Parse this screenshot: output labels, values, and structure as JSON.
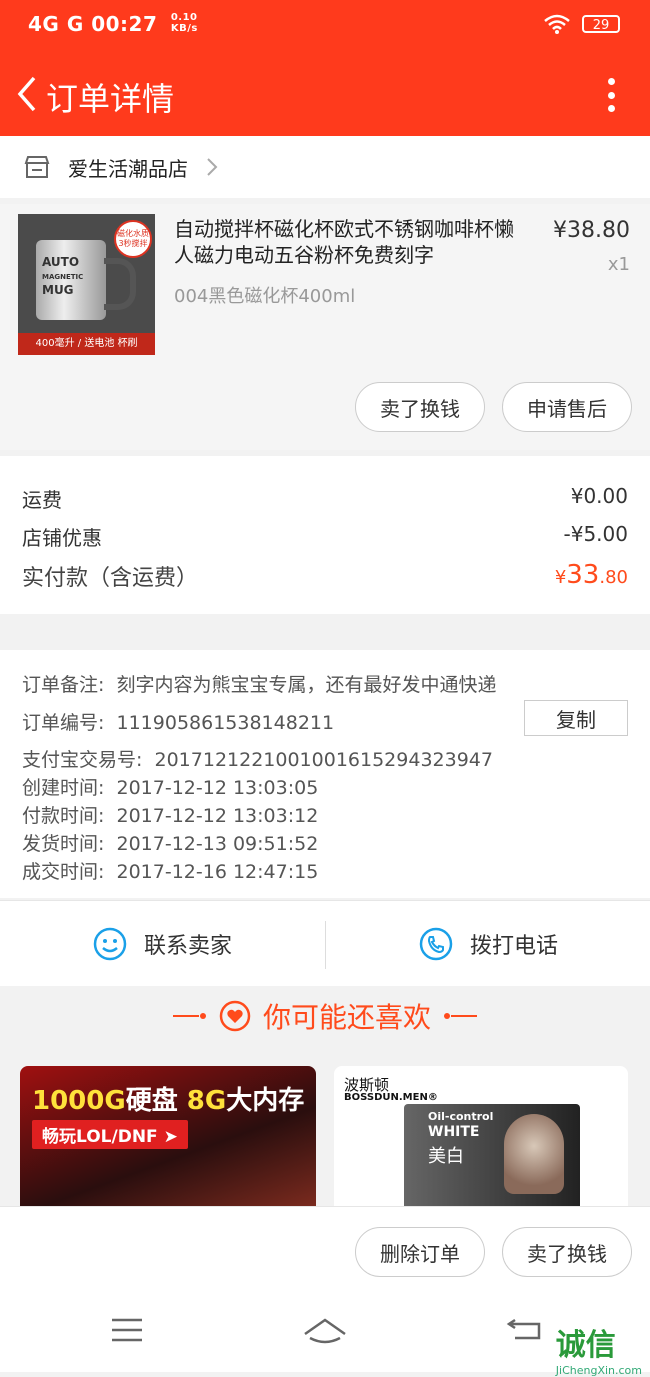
{
  "status_bar": {
    "network": "4G",
    "signal": "G",
    "time": "00:27",
    "speed_value": "0.10",
    "speed_unit": "KB/s",
    "battery": "29"
  },
  "header": {
    "title": "订单详情"
  },
  "shop": {
    "name": "爱生活潮品店"
  },
  "product": {
    "title": "自动搅拌杯磁化杯欧式不锈钢咖啡杯懒人磁力电动五谷粉杯免费刻字",
    "sku": "004黑色磁化杯400ml",
    "price": "¥38.80",
    "quantity": "x1",
    "image_text": {
      "line1": "AUTO",
      "line2": "MAGNETIC",
      "line3": "MUG",
      "badge": "磁化水质 3秒搅拌",
      "band": "400毫升 / 送电池 杯刷"
    },
    "actions": [
      "卖了换钱",
      "申请售后"
    ]
  },
  "fees": {
    "shipping_label": "运费",
    "shipping_value": "¥0.00",
    "discount_label": "店铺优惠",
    "discount_value": "-¥5.00",
    "paid_label": "实付款（含运费）",
    "paid_currency": "¥",
    "paid_int": "33",
    "paid_dec": ".80"
  },
  "order_info": {
    "note_label": "订单备注:",
    "note_value": "刻字内容为熊宝宝专属，还有最好发中通快递",
    "order_no_label": "订单编号:",
    "order_no_value": "111905861538148211",
    "copy_label": "复制",
    "alipay_label": "支付宝交易号:",
    "alipay_value": "2017121221001001615294323947",
    "created_label": "创建时间:",
    "created_value": "2017-12-12 13:03:05",
    "paid_label": "付款时间:",
    "paid_value": "2017-12-12 13:03:12",
    "shipped_label": "发货时间:",
    "shipped_value": "2017-12-13 09:51:52",
    "completed_label": "成交时间:",
    "completed_value": "2017-12-16 12:47:15"
  },
  "contact": {
    "seller": "联系卖家",
    "call": "拨打电话"
  },
  "recommend": {
    "title": "你可能还喜欢",
    "card1": {
      "headline_a": "1000G",
      "headline_b": "硬盘",
      "headline_c": "8G",
      "headline_d": "大内存",
      "tag": "畅玩LOL/DNF ➤"
    },
    "card2": {
      "brand": "波斯顿",
      "brand_en": "BOSSDUN.MEN®",
      "oil": "Oil-control",
      "white": "WHITE",
      "mb": "美白"
    }
  },
  "bottom_actions": {
    "delete": "删除订单",
    "sell": "卖了换钱"
  },
  "watermark": {
    "text": "诚信",
    "url": "JiChengXin.com"
  },
  "colors": {
    "brand": "#ff3a1c",
    "accent": "#ff4b1c"
  }
}
